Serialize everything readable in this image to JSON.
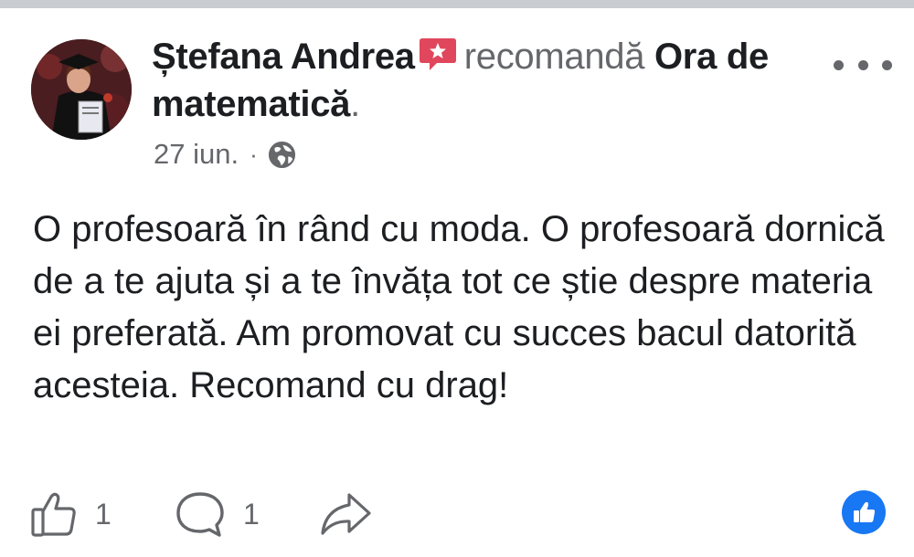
{
  "post": {
    "author": "Ștefana Andrea",
    "verb": "recomandă",
    "page_name": "Ora de matematică",
    "period": ".",
    "date": "27 iun.",
    "separator": "·",
    "privacy_icon": "globe-icon",
    "body": "O profesoară în rând cu moda. O profesoară dornică de a te ajuta și a te învăța tot ce știe despre materia ei preferată. Am promovat cu succes bacul datorită acesteia. Recomand cu drag!"
  },
  "actions": {
    "like_count": "1",
    "comment_count": "1"
  },
  "colors": {
    "text": "#1c1e21",
    "secondary": "#65676b",
    "brand_blue": "#1877f2",
    "badge_red": "#e0475d"
  }
}
